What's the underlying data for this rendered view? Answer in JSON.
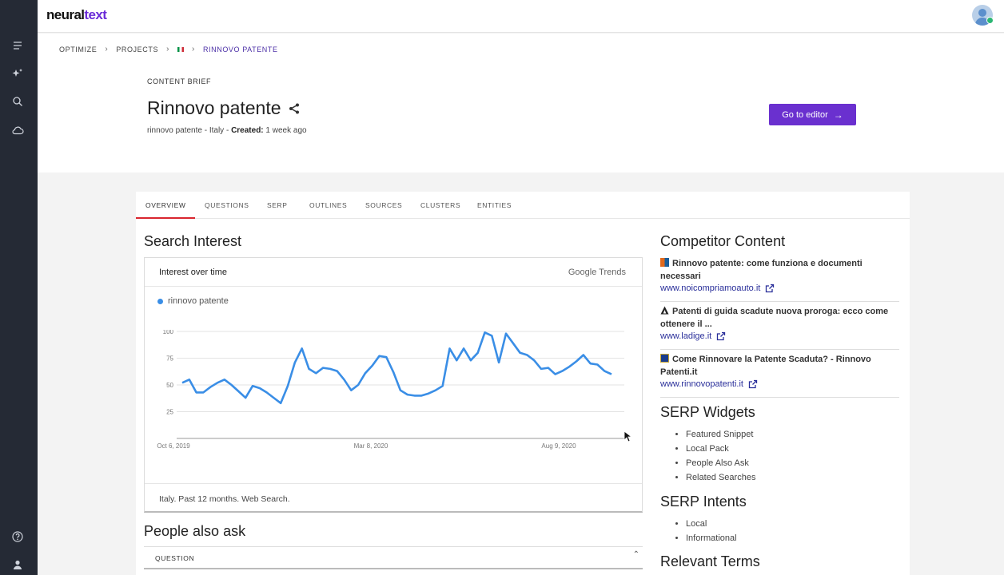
{
  "brand": {
    "logo_left": "neural",
    "logo_right": "text"
  },
  "breadcrumb": [
    "OPTIMIZE",
    "PROJECTS",
    "RINNOVO PATENTE"
  ],
  "header": {
    "section_label": "CONTENT BRIEF",
    "title": "Rinnovo patente",
    "meta_prefix": "rinnovo patente - Italy - ",
    "meta_created_label": "Created:",
    "meta_created_value": " 1 week ago",
    "editor_button": "Go to editor"
  },
  "tabs": [
    "OVERVIEW",
    "QUESTIONS",
    "SERP",
    "OUTLINES",
    "SOURCES",
    "CLUSTERS",
    "ENTITIES"
  ],
  "search_interest": {
    "heading": "Search Interest",
    "card_title": "Interest over time",
    "provider": "Google Trends",
    "footer": "Italy. Past 12 months. Web Search."
  },
  "chart_data": {
    "type": "line",
    "series": [
      {
        "name": "rinnovo patente",
        "color": "#3a8ee6",
        "values": [
          52,
          55,
          43,
          43,
          48,
          52,
          55,
          50,
          44,
          38,
          49,
          47,
          43,
          38,
          33,
          49,
          71,
          84,
          65,
          61,
          66,
          65,
          63,
          55,
          45,
          50,
          61,
          68,
          77,
          76,
          62,
          45,
          41,
          40,
          40,
          42,
          45,
          49,
          84,
          73,
          84,
          73,
          80,
          99,
          96,
          71,
          98,
          89,
          80,
          78,
          73,
          65,
          66,
          60,
          63,
          67,
          72,
          78,
          70,
          69,
          63,
          60
        ]
      }
    ],
    "x_ticks": [
      "Oct 6, 2019",
      "Mar 8, 2020",
      "Aug 9, 2020"
    ],
    "y_ticks": [
      25,
      50,
      75,
      100
    ],
    "ylim": [
      0,
      100
    ],
    "grid": true
  },
  "people_also_ask": {
    "heading": "People also ask",
    "column": "QUESTION"
  },
  "competitor": {
    "heading": "Competitor Content",
    "items": [
      {
        "title": "Rinnovo patente: come funziona e documenti necessari",
        "url": "www.noicompriamoauto.it",
        "color": "#e0691c"
      },
      {
        "title": "Patenti di guida scadute nuova proroga: ecco come ottenere il ...",
        "url": "www.ladige.it",
        "color": "#222222"
      },
      {
        "title": "Come Rinnovare la Patente Scaduta? - Rinnovo Patenti.it",
        "url": "www.rinnovopatenti.it",
        "color": "#1a3c8c"
      }
    ]
  },
  "serp_widgets": {
    "heading": "SERP Widgets",
    "items": [
      "Featured Snippet",
      "Local Pack",
      "People Also Ask",
      "Related Searches"
    ]
  },
  "serp_intents": {
    "heading": "SERP Intents",
    "items": [
      "Local",
      "Informational"
    ]
  },
  "relevant_terms": {
    "heading": "Relevant Terms"
  }
}
